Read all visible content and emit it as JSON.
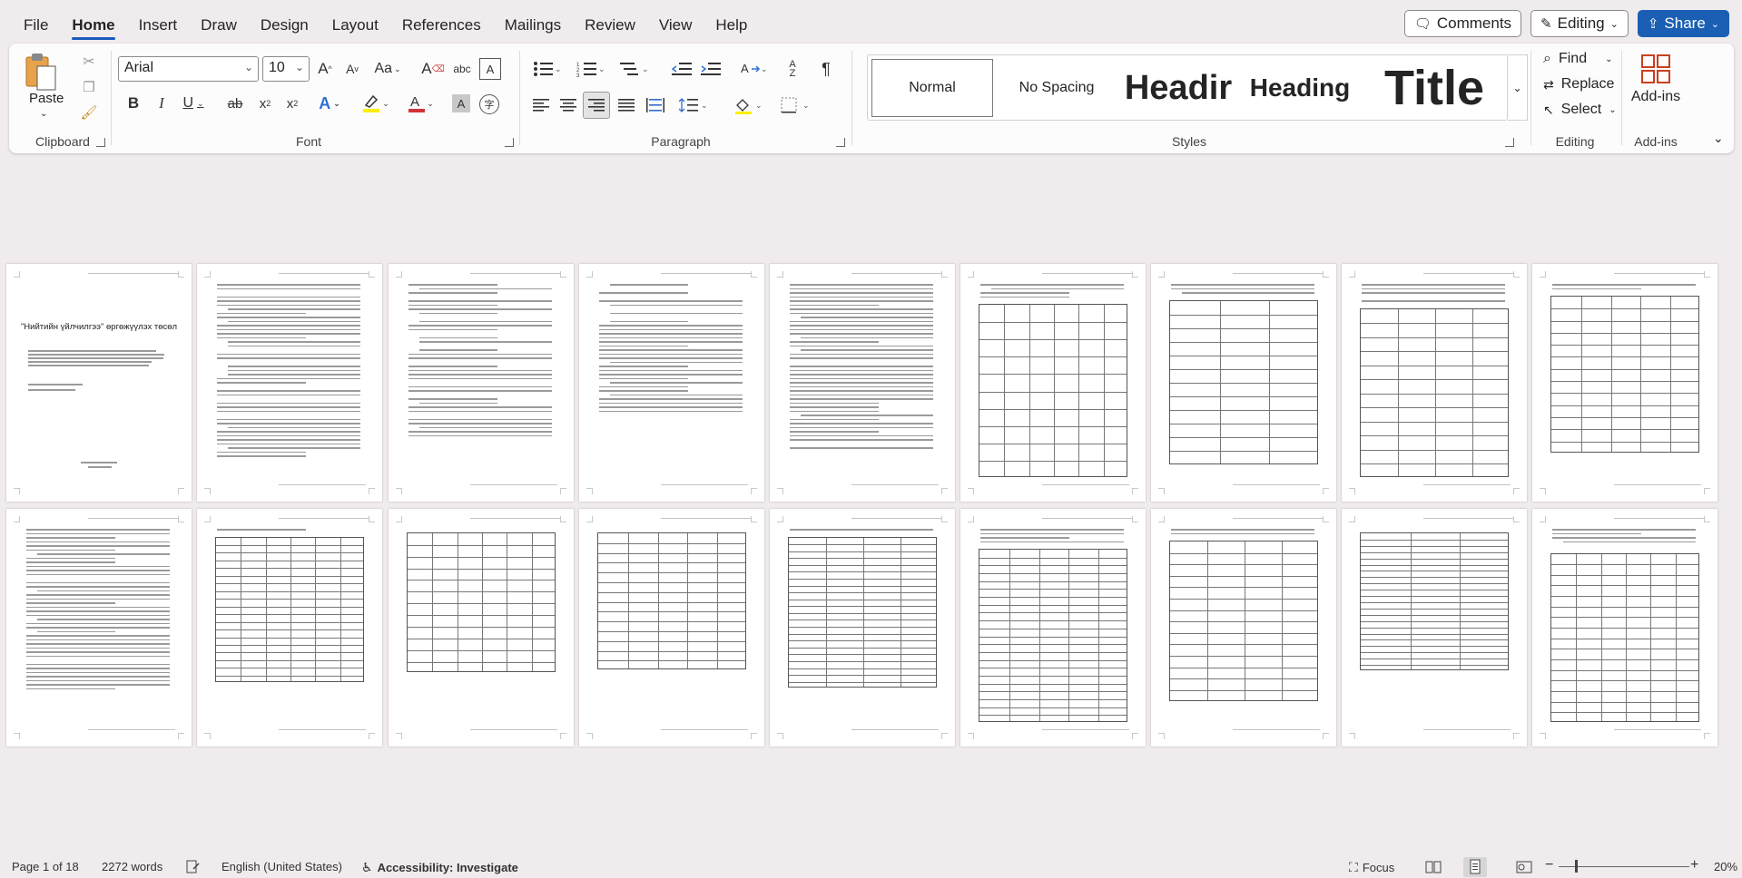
{
  "menu": {
    "tabs": [
      "File",
      "Home",
      "Insert",
      "Draw",
      "Design",
      "Layout",
      "References",
      "Mailings",
      "Review",
      "View",
      "Help"
    ],
    "active_index": 1,
    "comments_label": "Comments",
    "editing_label": "Editing",
    "share_label": "Share"
  },
  "ribbon": {
    "clipboard": {
      "label": "Clipboard",
      "paste_label": "Paste"
    },
    "font": {
      "label": "Font",
      "family": "Arial",
      "size": "10"
    },
    "paragraph": {
      "label": "Paragraph"
    },
    "styles": {
      "label": "Styles",
      "items": [
        "Normal",
        "No Spacing",
        "Headir",
        "Heading",
        "Title"
      ]
    },
    "editing": {
      "label": "Editing",
      "find": "Find",
      "replace": "Replace",
      "select": "Select"
    },
    "addins": {
      "label": "Add-ins",
      "button": "Add-ins"
    }
  },
  "document": {
    "cover_title": "\"Нийтийн үйлчилгээ\" өргөжүүлэх төсөл"
  },
  "status": {
    "page": "Page 1 of 18",
    "words": "2272 words",
    "language": "English (United States)",
    "accessibility": "Accessibility: Investigate",
    "focus": "Focus",
    "zoom": "20%"
  },
  "colors": {
    "accent": "#185abd",
    "share_bg": "#1a5fb4",
    "canvas_bg": "#f0ebec",
    "highlight": "#ffee00",
    "font_color": "#d13438"
  }
}
